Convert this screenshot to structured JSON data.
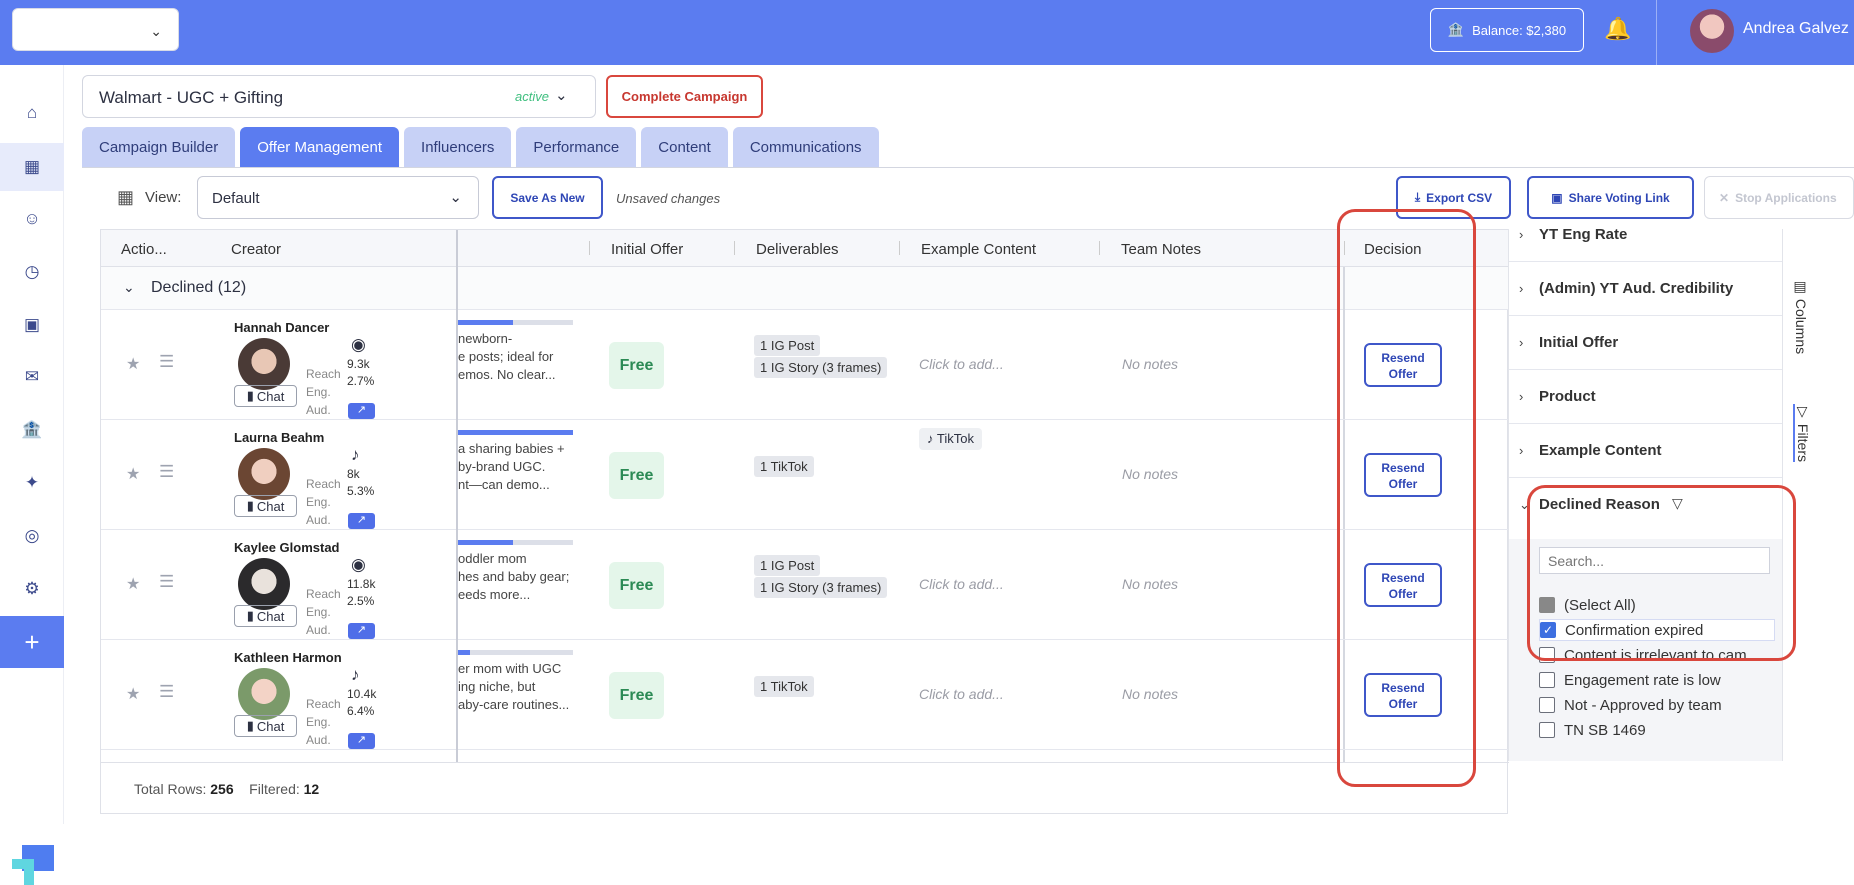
{
  "topbar": {
    "balance_label": "Balance: $2,380",
    "user_name": "Andrea Galvez"
  },
  "campaign": {
    "name": "Walmart - UGC + Gifting",
    "status": "active",
    "complete_label": "Complete Campaign"
  },
  "tabs": [
    "Campaign Builder",
    "Offer Management",
    "Influencers",
    "Performance",
    "Content",
    "Communications"
  ],
  "toolbar": {
    "view_label": "View:",
    "view_value": "Default",
    "save_as_new": "Save As New",
    "unsaved": "Unsaved changes",
    "export_csv": "Export CSV",
    "share_voting": "Share Voting Link",
    "stop_applications": "Stop Applications"
  },
  "grid": {
    "headers": [
      "Actio...",
      "Creator",
      "Initial Offer",
      "Deliverables",
      "Example Content",
      "Team Notes",
      "Decision"
    ],
    "group_label": "Declined (12)",
    "stat_labels": [
      "Reach",
      "Eng.",
      "Aud."
    ],
    "chat_label": "Chat",
    "rows": [
      {
        "name": "Hannah Dancer",
        "platform": "instagram",
        "reach": "9.3k",
        "eng": "2.7%",
        "bar": 0.48,
        "bio": [
          "newborn-",
          "e posts; ideal for",
          "emos. No clear..."
        ],
        "offer": "Free",
        "deliverables": [
          "1 IG Post",
          "1 IG Story (3 frames)"
        ],
        "example": "Click to add...",
        "example_chip": "",
        "notes": "No notes",
        "decision": [
          "Resend",
          "Offer"
        ]
      },
      {
        "name": "Laurna Beahm",
        "platform": "tiktok",
        "reach": "8k",
        "eng": "5.3%",
        "bar": 1.0,
        "bio": [
          "a sharing babies +",
          "by-brand UGC.",
          "nt—can demo..."
        ],
        "offer": "Free",
        "deliverables": [
          "1 TikTok"
        ],
        "example": "",
        "example_chip": "TikTok",
        "notes": "No notes",
        "decision": [
          "Resend",
          "Offer"
        ]
      },
      {
        "name": "Kaylee Glomstad",
        "platform": "instagram",
        "reach": "11.8k",
        "eng": "2.5%",
        "bar": 0.48,
        "bio": [
          "oddler mom",
          "hes and baby gear;",
          "eeds more..."
        ],
        "offer": "Free",
        "deliverables": [
          "1 IG Post",
          "1 IG Story (3 frames)"
        ],
        "example": "Click to add...",
        "example_chip": "",
        "notes": "No notes",
        "decision": [
          "Resend",
          "Offer"
        ]
      },
      {
        "name": "Kathleen Harmon",
        "platform": "tiktok",
        "reach": "10.4k",
        "eng": "6.4%",
        "bar": 0.1,
        "bio": [
          "er mom with UGC",
          "ing niche, but",
          "aby-care routines..."
        ],
        "offer": "Free",
        "deliverables": [
          "1 TikTok"
        ],
        "example": "Click to add...",
        "example_chip": "",
        "notes": "No notes",
        "decision": [
          "Resend",
          "Offer"
        ]
      }
    ],
    "footer_total_label": "Total Rows:",
    "footer_total": "256",
    "footer_filtered_label": "Filtered:",
    "footer_filtered": "12"
  },
  "filters": {
    "sections": [
      "YT Eng Rate",
      "(Admin) YT Aud. Credibility",
      "Initial Offer",
      "Product",
      "Example Content"
    ],
    "expanded_title": "Declined Reason",
    "search_placeholder": "Search...",
    "options": [
      {
        "label": "(Select All)",
        "state": "indeterminate"
      },
      {
        "label": "Confirmation expired",
        "state": "checked"
      },
      {
        "label": "Content is irrelevant to cam...",
        "state": "unchecked"
      },
      {
        "label": "Engagement rate is low",
        "state": "unchecked"
      },
      {
        "label": "Not - Approved by team",
        "state": "unchecked"
      },
      {
        "label": "TN SB 1469",
        "state": "unchecked"
      }
    ],
    "side_tabs": [
      "Columns",
      "Filters"
    ]
  },
  "colors": {
    "brand": "#5b7cf0",
    "highlight": "#d9473d"
  }
}
